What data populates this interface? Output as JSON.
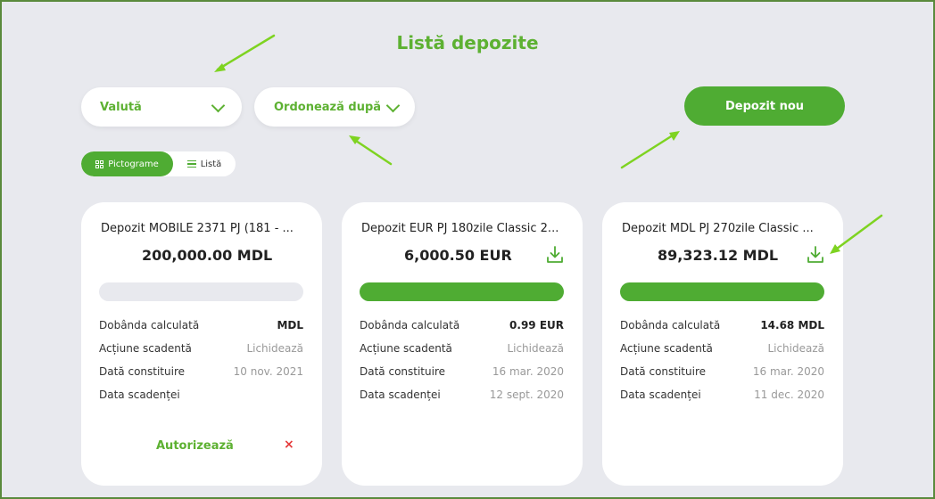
{
  "page": {
    "title": "Listă depozite"
  },
  "filters": {
    "currency_label": "Valută",
    "sort_label": "Ordonează după"
  },
  "actions": {
    "new_deposit_label": "Depozit nou"
  },
  "view_toggle": {
    "icons_label": "Pictograme",
    "list_label": "Listă",
    "active": "icons"
  },
  "cards": [
    {
      "name": "Depozit MOBILE 2371 PJ (181 - ...",
      "amount": "200,000.00 MDL",
      "progress": 0,
      "show_download": false,
      "rows": [
        {
          "label": "Dobânda calculată",
          "value": "MDL"
        },
        {
          "label": "Acțiune scadentă",
          "value": "Lichidează"
        },
        {
          "label": "Dată constituire",
          "value": "10 nov. 2021"
        },
        {
          "label": "Data scadenței",
          "value": ""
        }
      ],
      "authorize_label": "Autorizează",
      "cancel_glyph": "×"
    },
    {
      "name": "Depozit EUR PJ 180zile Classic 2...",
      "amount": "6,000.50 EUR",
      "progress": 1,
      "show_download": true,
      "rows": [
        {
          "label": "Dobânda calculată",
          "value": "0.99 EUR"
        },
        {
          "label": "Acțiune scadentă",
          "value": "Lichidează"
        },
        {
          "label": "Dată constituire",
          "value": "16 mar. 2020"
        },
        {
          "label": "Data scadenței",
          "value": "12 sept. 2020"
        }
      ]
    },
    {
      "name": "Depozit MDL PJ 270zile Classic ...",
      "amount": "89,323.12 MDL",
      "progress": 1,
      "show_download": true,
      "rows": [
        {
          "label": "Dobânda calculată",
          "value": "14.68 MDL"
        },
        {
          "label": "Acțiune scadentă",
          "value": "Lichidează"
        },
        {
          "label": "Dată constituire",
          "value": "16 mar. 2020"
        },
        {
          "label": "Data scadenței",
          "value": "11 dec. 2020"
        }
      ]
    }
  ],
  "colors": {
    "accent": "#4fac33",
    "title": "#5db132",
    "background": "#e8e9ee",
    "danger": "#e5393a",
    "annotation": "#7ed321"
  }
}
